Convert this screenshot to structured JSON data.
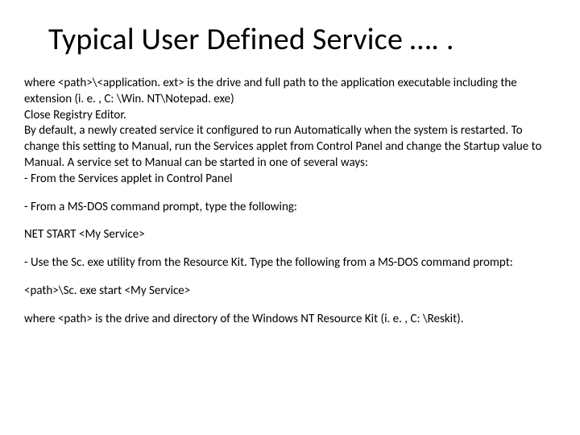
{
  "title": "Typical User Defined Service …. .",
  "paragraphs": {
    "p1": "where <path>\\<application. ext> is the drive and full path to the application executable including the extension (i. e. , C: \\Win. NT\\Notepad. exe)",
    "p2": "Close Registry Editor.",
    "p3": "By default, a newly created service it configured to run Automatically when the system is restarted. To change this setting to Manual, run the Services applet from Control Panel and change the Startup value to Manual. A service set to Manual can be started in one of several ways:",
    "p4": "- From the Services applet in Control Panel",
    "p5": "- From a MS-DOS command prompt, type the following:",
    "p6": "NET START <My Service>",
    "p7": "- Use the Sc. exe utility from the Resource Kit. Type the following from a MS-DOS command prompt:",
    "p8": "<path>\\Sc. exe start <My Service>",
    "p9": "where <path> is the drive and directory of the Windows NT Resource Kit (i. e. , C: \\Reskit)."
  }
}
